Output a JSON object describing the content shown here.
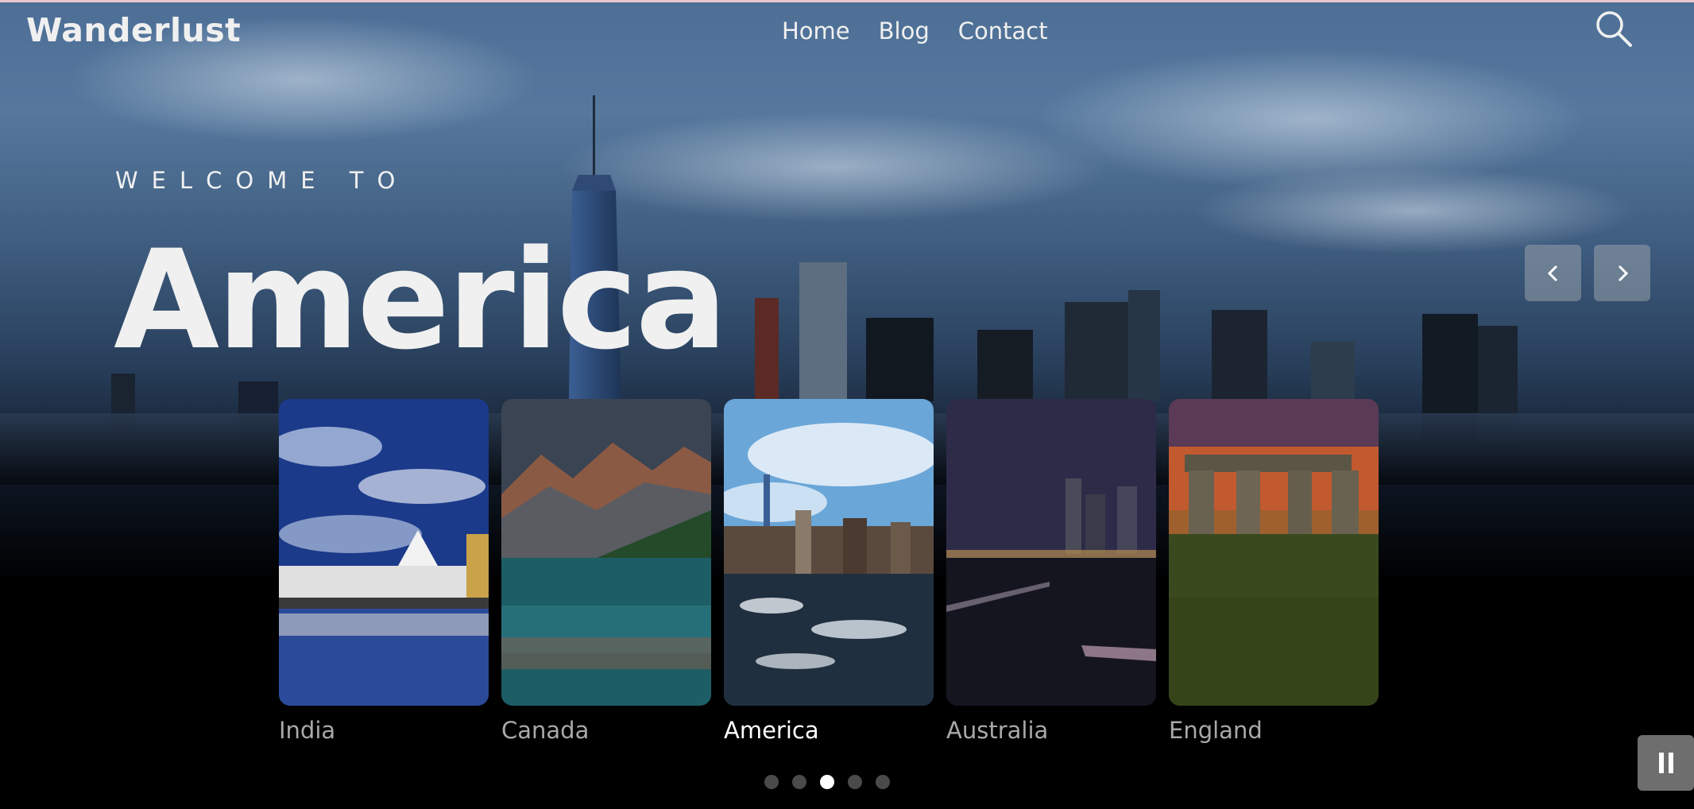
{
  "header": {
    "logo": "Wanderlust",
    "nav": [
      {
        "label": "Home"
      },
      {
        "label": "Blog"
      },
      {
        "label": "Contact"
      }
    ],
    "search_icon": "search-icon"
  },
  "hero": {
    "eyebrow": "WELCOME TO",
    "title": "America",
    "prev_icon": "chevron-left-icon",
    "next_icon": "chevron-right-icon"
  },
  "cards": [
    {
      "label": "India",
      "active": false
    },
    {
      "label": "Canada",
      "active": false
    },
    {
      "label": "America",
      "active": true
    },
    {
      "label": "Australia",
      "active": false
    },
    {
      "label": "England",
      "active": false
    }
  ],
  "pagination": {
    "count": 5,
    "active_index": 2
  },
  "controls": {
    "pause_icon": "pause-icon"
  },
  "colors": {
    "text": "#f0f0f0",
    "inactive_label": "#a9a9a9",
    "dot_inactive": "#4a4a4a",
    "dot_active": "#ffffff"
  }
}
